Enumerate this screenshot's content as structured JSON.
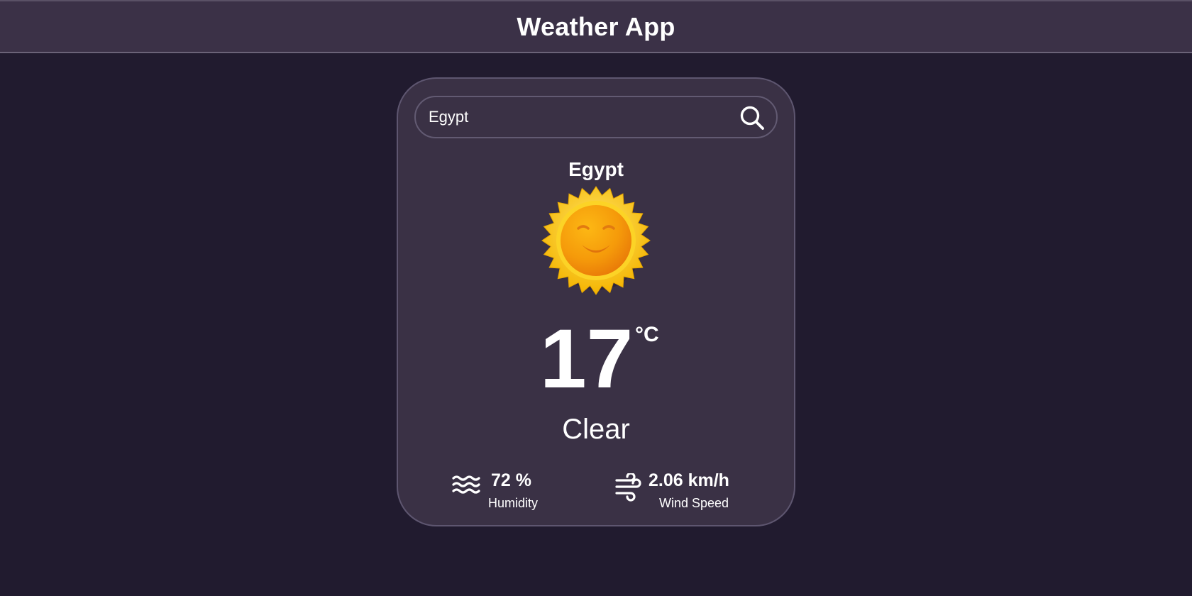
{
  "header": {
    "title": "Weather App"
  },
  "search": {
    "value": "Egypt",
    "icon": "search-icon"
  },
  "weather": {
    "city": "Egypt",
    "icon": "sun-icon",
    "temperature": "17",
    "unit": "°C",
    "condition": "Clear"
  },
  "stats": {
    "humidity": {
      "value": "72 %",
      "label": "Humidity",
      "icon": "humidity-waves-icon"
    },
    "wind": {
      "value": "2.06 km/h",
      "label": "Wind Speed",
      "icon": "wind-icon"
    }
  },
  "colors": {
    "page_background": "#211b2f",
    "header_background": "#3b3147",
    "card_background": "#3a3145",
    "card_border": "#5e5670",
    "text": "#ffffff",
    "sun_rays": "#f9c30c",
    "sun_face": "#f08a03"
  }
}
